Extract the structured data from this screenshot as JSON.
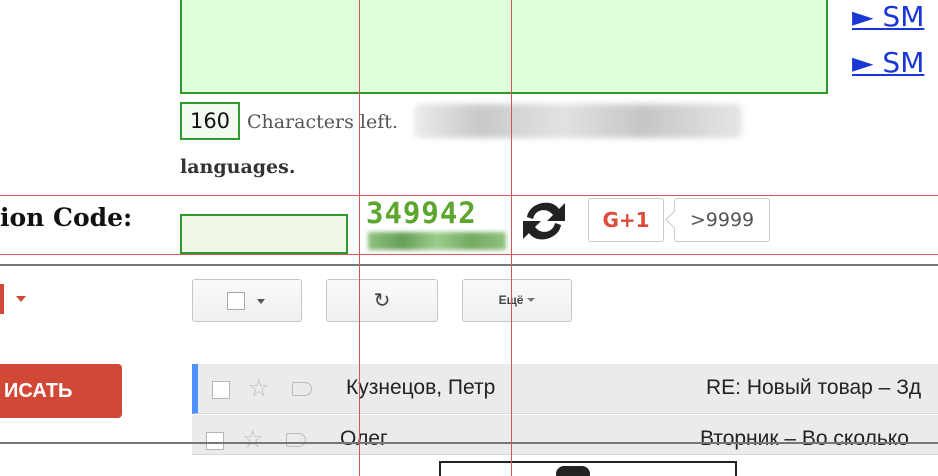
{
  "sms_links": [
    "► SM",
    "► SM"
  ],
  "message": {
    "counter": "160",
    "counter_suffix": "Characters left.",
    "languages_text": "languages."
  },
  "verification": {
    "label": "ion Code:",
    "captcha_code": "349942",
    "gplus_label": "G+1",
    "gplus_count": ">9999"
  },
  "gmail": {
    "more_label": "Ещё",
    "refresh_glyph": "↻",
    "compose_label": "ИСАТЬ",
    "rows": [
      {
        "sender": "Кузнецов, Петр",
        "subject": "RE: Новый товар – Зд",
        "selected": true
      },
      {
        "sender": "Олег",
        "subject": "Вторник – Во сколько",
        "selected": false
      }
    ]
  },
  "colors": {
    "accent_green": "#2e9a2e",
    "captcha_green": "#5ca62e",
    "link_blue": "#1a37d6",
    "gmail_red": "#d14836",
    "guide_red": "#d25555"
  }
}
